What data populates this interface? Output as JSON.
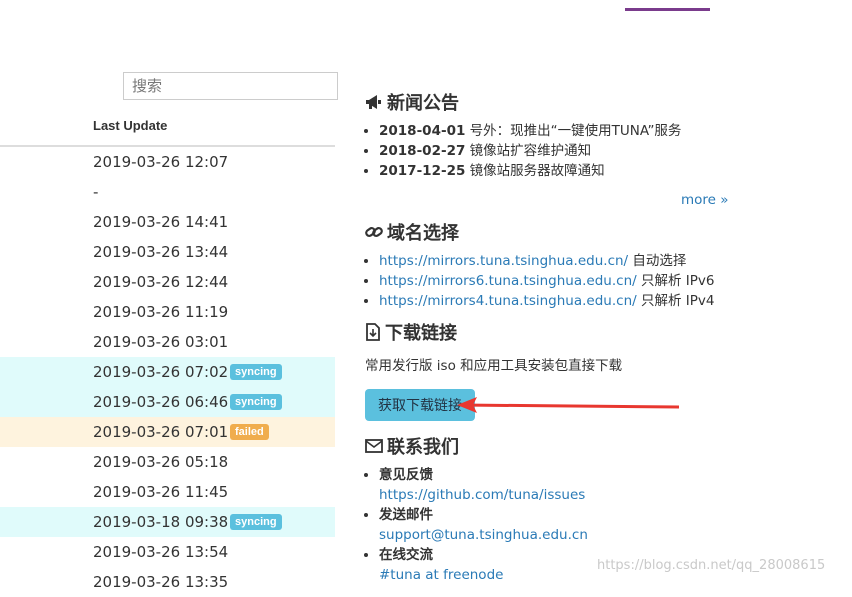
{
  "search": {
    "placeholder": "搜索"
  },
  "table": {
    "column_header": "Last Update",
    "rows": [
      {
        "date": "2019-03-26 12:07",
        "status": ""
      },
      {
        "date": "-",
        "status": ""
      },
      {
        "date": "2019-03-26 14:41",
        "status": ""
      },
      {
        "date": "2019-03-26 13:44",
        "status": ""
      },
      {
        "date": "2019-03-26 12:44",
        "status": ""
      },
      {
        "date": "2019-03-26 11:19",
        "status": ""
      },
      {
        "date": "2019-03-26 03:01",
        "status": ""
      },
      {
        "date": "2019-03-26 07:02",
        "status": "syncing"
      },
      {
        "date": "2019-03-26 06:46",
        "status": "syncing"
      },
      {
        "date": "2019-03-26 07:01",
        "status": "failed"
      },
      {
        "date": "2019-03-26 05:18",
        "status": ""
      },
      {
        "date": "2019-03-26 11:45",
        "status": ""
      },
      {
        "date": "2019-03-18 09:38",
        "status": "syncing"
      },
      {
        "date": "2019-03-26 13:54",
        "status": ""
      },
      {
        "date": "2019-03-26 13:35",
        "status": ""
      }
    ]
  },
  "news": {
    "title": "新闻公告",
    "items": [
      {
        "date": "2018-04-01",
        "text": " 号外：现推出“一键使用TUNA”服务"
      },
      {
        "date": "2018-02-27",
        "text": " 镜像站扩容维护通知"
      },
      {
        "date": "2017-12-25",
        "text": " 镜像站服务器故障通知"
      }
    ],
    "more": "more »"
  },
  "domains": {
    "title": "域名选择",
    "items": [
      {
        "url": "https://mirrors.tuna.tsinghua.edu.cn/",
        "note": " 自动选择"
      },
      {
        "url": "https://mirrors6.tuna.tsinghua.edu.cn/",
        "note": " 只解析 IPv6"
      },
      {
        "url": "https://mirrors4.tuna.tsinghua.edu.cn/",
        "note": " 只解析 IPv4"
      }
    ]
  },
  "download": {
    "title": "下载链接",
    "desc": "常用发行版 iso 和应用工具安装包直接下载",
    "button": "获取下载链接"
  },
  "contact": {
    "title": "联系我们",
    "items": [
      {
        "label": "意见反馈",
        "link": "https://github.com/tuna/issues"
      },
      {
        "label": "发送邮件",
        "link": "support@tuna.tsinghua.edu.cn"
      },
      {
        "label": "在线交流",
        "link": "#tuna at freenode"
      }
    ]
  },
  "watermark": "https://blog.csdn.net/qq_28008615",
  "colors": {
    "accent": "#7a3b8c",
    "syncing": "#5bc0de",
    "failed": "#f0ad4e",
    "link": "#2a7ab6",
    "arrow": "#e8372f"
  }
}
